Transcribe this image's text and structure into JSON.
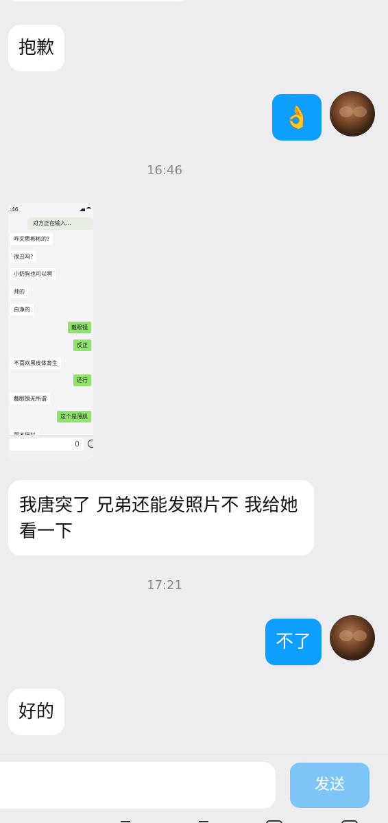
{
  "messages": {
    "m1": "抱歉",
    "m2_emoji": "👌",
    "time1": "16:46",
    "screenshot": {
      "status_time": ":46",
      "typing": "对方正在输入...",
      "rows": [
        {
          "side": "in",
          "text": "咋文质彬彬的?"
        },
        {
          "side": "in",
          "text": "很丑吗?"
        },
        {
          "side": "in",
          "text": "小奶狗也可以啊"
        },
        {
          "side": "in",
          "text": "帅的"
        },
        {
          "side": "in",
          "text": "白净的"
        },
        {
          "side": "out",
          "text": "戴眼镜"
        },
        {
          "side": "out",
          "text": "反正"
        },
        {
          "side": "in",
          "text": "不喜欢黑皮体育生"
        },
        {
          "side": "out",
          "text": "还行"
        },
        {
          "side": "in",
          "text": "戴眼镜无所谓"
        },
        {
          "side": "out",
          "text": "这个是薄肌"
        },
        {
          "side": "in",
          "text": "那不挺好"
        }
      ]
    },
    "m3": "我唐突了 兄弟还能发照片不 我给她看一下",
    "time2": "17:21",
    "m4": "不了",
    "m5": "好的"
  },
  "input": {
    "placeholder": "",
    "send_label": "发送"
  }
}
